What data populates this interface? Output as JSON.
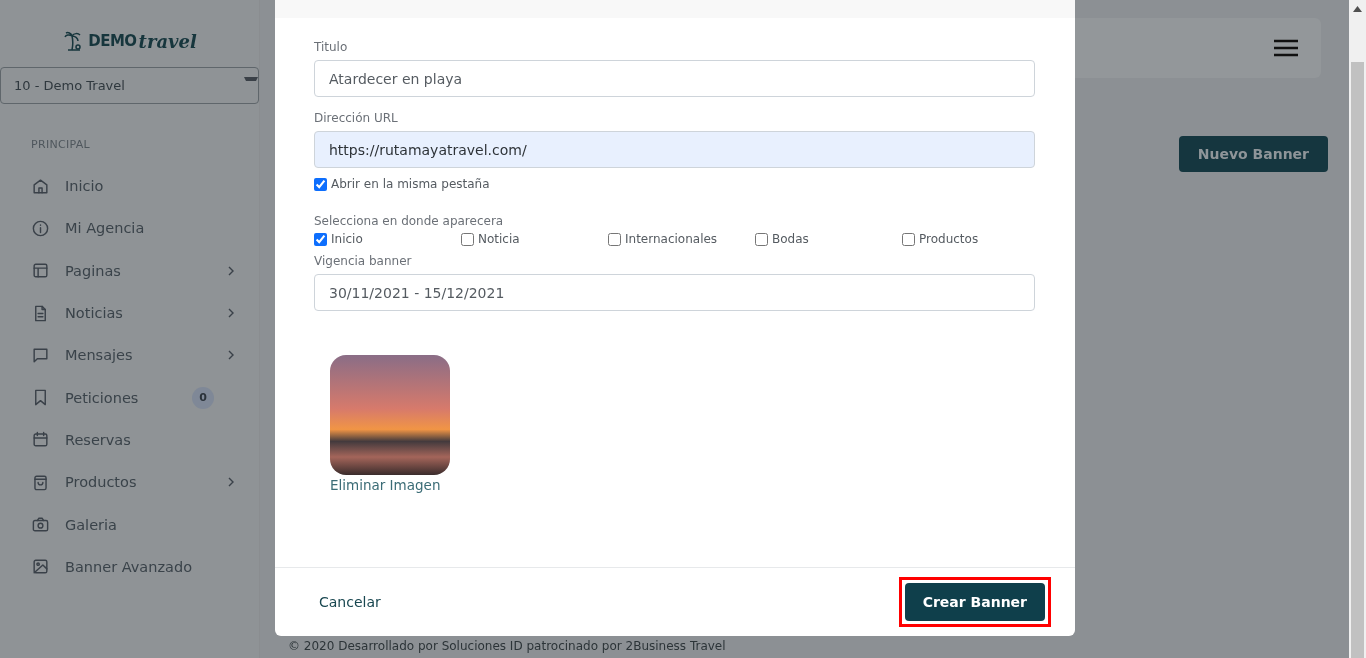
{
  "sidebar": {
    "logo": {
      "word_1": "DEMO",
      "word_2": "travel"
    },
    "agency_select": {
      "value": "10 - Demo Travel"
    },
    "section_label": "PRINCIPAL",
    "items": [
      {
        "label": "Inicio",
        "submenu": false
      },
      {
        "label": "Mi Agencia",
        "submenu": false
      },
      {
        "label": "Paginas",
        "submenu": true
      },
      {
        "label": "Noticias",
        "submenu": true
      },
      {
        "label": "Mensajes",
        "submenu": true
      },
      {
        "label": "Peticiones",
        "submenu": false,
        "badge": "0"
      },
      {
        "label": "Reservas",
        "submenu": false
      },
      {
        "label": "Productos",
        "submenu": true
      },
      {
        "label": "Galeria",
        "submenu": false
      },
      {
        "label": "Banner Avanzado",
        "submenu": false
      }
    ]
  },
  "page": {
    "new_button": "Nuevo Banner",
    "footer": "© 2020 Desarrollado por Soluciones ID patrocinado por 2Business Travel"
  },
  "modal": {
    "fields": [
      {
        "label": "Titulo",
        "value": "Atardecer en playa",
        "autofilled": false
      },
      {
        "label": "Dirección URL",
        "value": "https://rutamayatravel.com/",
        "autofilled": true
      }
    ],
    "same_tab": {
      "label": "Abrir en la misma pestaña",
      "checked": true
    },
    "placement": {
      "label": "Selecciona en donde aparecera",
      "options": [
        {
          "label": "Inicio",
          "checked": true
        },
        {
          "label": "Noticia",
          "checked": false
        },
        {
          "label": "Internacionales",
          "checked": false
        },
        {
          "label": "Bodas",
          "checked": false
        },
        {
          "label": "Productos",
          "checked": false
        }
      ]
    },
    "validity": {
      "label": "Vigencia banner",
      "value": "30/11/2021 - 15/12/2021"
    },
    "image": {
      "action": "Eliminar Imagen"
    },
    "cancel": "Cancelar",
    "submit": {
      "label": "Crear Banner",
      "highlighted": true
    }
  }
}
